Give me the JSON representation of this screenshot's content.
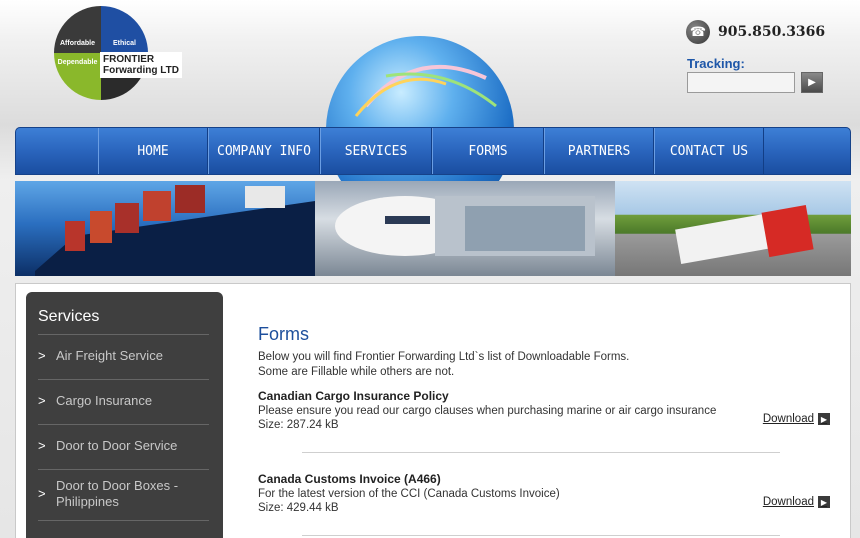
{
  "header": {
    "logo": {
      "quadrants": [
        "Affordable",
        "Ethical",
        "Dependable"
      ],
      "name_line1": "FRONTIER",
      "name_line2": "Forwarding LTD",
      "colors": {
        "dark": "#3a3a3a",
        "blue": "#1f4fa3",
        "green": "#8ab82b"
      }
    },
    "phone": {
      "icon": "phone-icon",
      "number": "905.850.3366"
    },
    "tracking": {
      "label": "Tracking:",
      "value": "",
      "button_icon": "play-arrow-icon"
    }
  },
  "nav": {
    "items": [
      {
        "label": "HOME"
      },
      {
        "label": "COMPANY INFO"
      },
      {
        "label": "SERVICES"
      },
      {
        "label": "FORMS"
      },
      {
        "label": "PARTNERS"
      },
      {
        "label": "CONTACT US"
      }
    ],
    "color": "#2a65bd"
  },
  "banner": {
    "panels": [
      "container-ship",
      "airplane-at-gate",
      "truck-on-highway"
    ]
  },
  "sidebar": {
    "title": "Services",
    "items": [
      {
        "label": "Air Freight Service"
      },
      {
        "label": "Cargo Insurance"
      },
      {
        "label": "Door to Door Service"
      },
      {
        "label": "Door to Door Boxes - Philippines"
      }
    ]
  },
  "main": {
    "title": "Forms",
    "intro_line1": "Below you will find Frontier Forwarding Ltd`s list of Downloadable Forms.",
    "intro_line2": "Some are Fillable while others are not.",
    "forms": [
      {
        "title": "Canadian Cargo Insurance Policy",
        "description": "Please ensure you read our cargo clauses when purchasing marine or air cargo insurance",
        "size": "Size: 287.24 kB",
        "download_label": "Download"
      },
      {
        "title": "Canada Customs Invoice (A466)",
        "description": "For the latest version of the CCI (Canada Customs Invoice)",
        "size": "Size: 429.44 kB",
        "download_label": "Download"
      }
    ]
  }
}
